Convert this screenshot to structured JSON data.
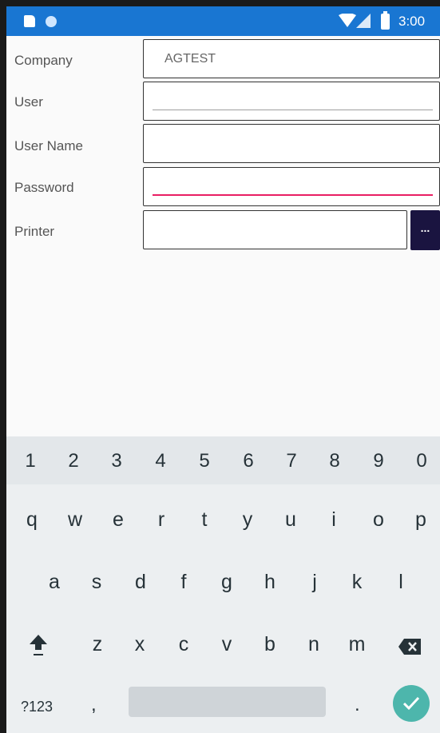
{
  "status_bar": {
    "time": "3:00"
  },
  "form": {
    "company_label": "Company",
    "company_value": "AGTEST",
    "user_label": "User",
    "user_value": "",
    "user_name_label": "User Name",
    "user_name_value": "",
    "password_label": "Password",
    "password_value": "",
    "printer_label": "Printer",
    "printer_value": "",
    "browse_label": "..."
  },
  "keyboard": {
    "number_row": [
      "1",
      "2",
      "3",
      "4",
      "5",
      "6",
      "7",
      "8",
      "9",
      "0"
    ],
    "row1": [
      "q",
      "w",
      "e",
      "r",
      "t",
      "y",
      "u",
      "i",
      "o",
      "p"
    ],
    "row2": [
      "a",
      "s",
      "d",
      "f",
      "g",
      "h",
      "j",
      "k",
      "l"
    ],
    "row3": [
      "z",
      "x",
      "c",
      "v",
      "b",
      "n",
      "m"
    ],
    "symbols_label": "?123",
    "comma": ",",
    "period": "."
  },
  "colors": {
    "status_bar": "#1976d2",
    "focus_underline": "#e91e63",
    "browse_button": "#1a1440",
    "enter_button": "#4db6ac"
  }
}
